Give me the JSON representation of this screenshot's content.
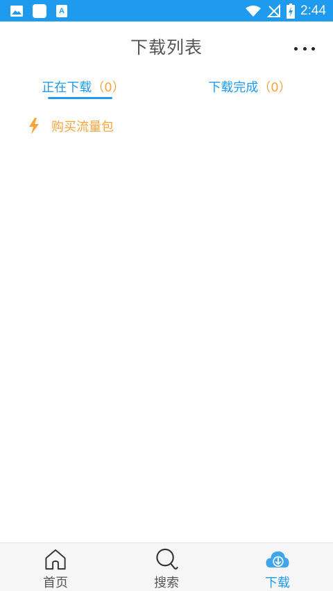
{
  "status_bar": {
    "time": "2:44",
    "background_color": "#1e9bef",
    "left_icons": [
      "image-icon",
      "square-app-icon",
      "a-text-icon"
    ],
    "right_icons": [
      "wifi-icon",
      "no-signal-icon",
      "battery-charging-icon"
    ]
  },
  "header": {
    "title": "下载列表",
    "more_icon": "more-horizontal-icon"
  },
  "tabs": [
    {
      "label": "正在下载",
      "count": "（0）",
      "active": true
    },
    {
      "label": "下载完成",
      "count": "（0）",
      "active": false
    }
  ],
  "promo": {
    "icon": "lightning-icon",
    "label": "购买流量包"
  },
  "bottom_nav": [
    {
      "label": "首页",
      "icon": "home-icon",
      "active": false
    },
    {
      "label": "搜索",
      "icon": "search-icon",
      "active": false
    },
    {
      "label": "下载",
      "icon": "cloud-download-icon",
      "active": true
    }
  ],
  "colors": {
    "accent": "#1e9bef",
    "highlight": "#f4a53c",
    "title_text": "#555555"
  }
}
